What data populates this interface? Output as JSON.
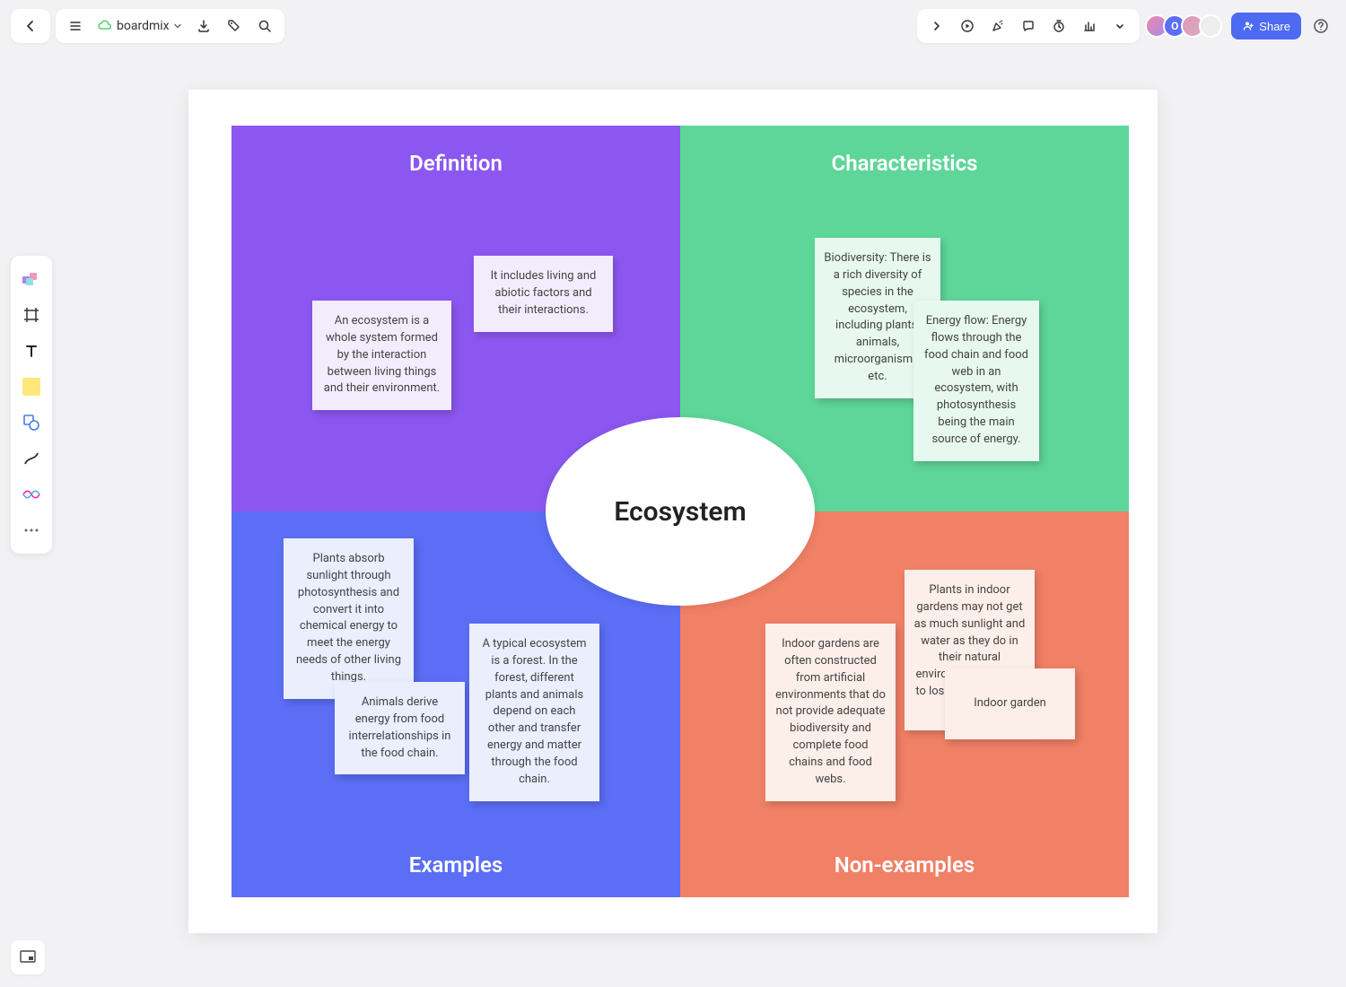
{
  "header": {
    "brand": "boardmix",
    "share_label": "Share",
    "avatar_letter": "O"
  },
  "tools": {
    "template": "template-icon",
    "frame": "frame-icon",
    "text": "text-icon",
    "sticky": "sticky-note-icon",
    "shape": "shape-icon",
    "connector": "connector-icon",
    "wave": "wave-icon",
    "more": "more-icon"
  },
  "diagram": {
    "center": "Ecosystem",
    "quads": {
      "definition": {
        "title": "Definition",
        "notes": [
          "An ecosystem is a whole system formed by the interaction between living things and their environment.",
          "It includes living and abiotic factors and their interactions."
        ]
      },
      "characteristics": {
        "title": "Characteristics",
        "notes": [
          "Biodiversity: There is a rich diversity of species in the ecosystem, including plants, animals, microorganisms, etc.",
          "Energy flow: Energy flows through the food chain and food web in an ecosystem, with photosynthesis being the main source of energy."
        ]
      },
      "examples": {
        "title": "Examples",
        "notes": [
          "Plants absorb sunlight through photosynthesis and convert it into chemical energy to meet the energy needs of other living things.",
          "Animals derive energy from food interrelationships in the food chain.",
          "A typical ecosystem is a forest. In the forest, different plants and animals depend on each other and transfer energy and matter through the food chain."
        ]
      },
      "nonexamples": {
        "title": "Non-examples",
        "notes": [
          "Indoor gardens are often constructed from artificial environments that do not provide adequate biodiversity and complete food chains and food webs.",
          "Plants in indoor gardens may not get as much sunlight and water as they do in their natural environment, leading to loss of ecosystem balance.",
          "Indoor garden"
        ]
      }
    }
  }
}
